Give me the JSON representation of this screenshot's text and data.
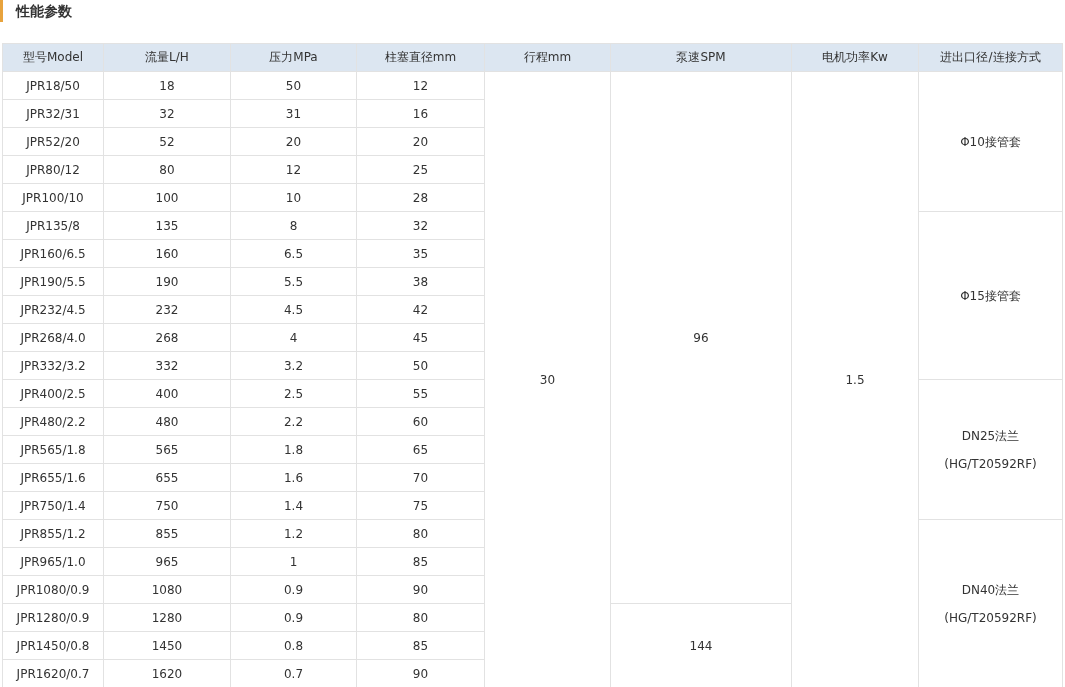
{
  "section_title": "性能参数",
  "table": {
    "columns": [
      "型号Model",
      "流量L/H",
      "压力MPa",
      "柱塞直径mm",
      "行程mm",
      "泵速SPM",
      "电机功率Kw",
      "进出口径/连接方式"
    ],
    "rows": [
      {
        "cells": [
          "JPR18/50",
          "18",
          "50",
          "12"
        ],
        "merged": {
          "stroke": "30",
          "speed": "96",
          "power": "1.5",
          "connection": [
            "Φ10接管套"
          ]
        }
      },
      {
        "cells": [
          "JPR32/31",
          "32",
          "31",
          "16"
        ]
      },
      {
        "cells": [
          "JPR52/20",
          "52",
          "20",
          "20"
        ]
      },
      {
        "cells": [
          "JPR80/12",
          "80",
          "12",
          "25"
        ]
      },
      {
        "cells": [
          "JPR100/10",
          "100",
          "10",
          "28"
        ]
      },
      {
        "cells": [
          "JPR135/8",
          "135",
          "8",
          "32"
        ],
        "merged": {
          "connection": [
            "Φ15接管套"
          ]
        }
      },
      {
        "cells": [
          "JPR160/6.5",
          "160",
          "6.5",
          "35"
        ]
      },
      {
        "cells": [
          "JPR190/5.5",
          "190",
          "5.5",
          "38"
        ]
      },
      {
        "cells": [
          "JPR232/4.5",
          "232",
          "4.5",
          "42"
        ]
      },
      {
        "cells": [
          "JPR268/4.0",
          "268",
          "4",
          "45"
        ]
      },
      {
        "cells": [
          "JPR332/3.2",
          "332",
          "3.2",
          "50"
        ]
      },
      {
        "cells": [
          "JPR400/2.5",
          "400",
          "2.5",
          "55"
        ],
        "merged": {
          "connection": [
            "DN25法兰",
            "(HG/T20592RF)"
          ]
        }
      },
      {
        "cells": [
          "JPR480/2.2",
          "480",
          "2.2",
          "60"
        ]
      },
      {
        "cells": [
          "JPR565/1.8",
          "565",
          "1.8",
          "65"
        ]
      },
      {
        "cells": [
          "JPR655/1.6",
          "655",
          "1.6",
          "70"
        ]
      },
      {
        "cells": [
          "JPR750/1.4",
          "750",
          "1.4",
          "75"
        ]
      },
      {
        "cells": [
          "JPR855/1.2",
          "855",
          "1.2",
          "80"
        ],
        "merged": {
          "connection": [
            "DN40法兰",
            "(HG/T20592RF)"
          ]
        }
      },
      {
        "cells": [
          "JPR965/1.0",
          "965",
          "1",
          "85"
        ]
      },
      {
        "cells": [
          "JPR1080/0.9",
          "1080",
          "0.9",
          "90"
        ]
      },
      {
        "cells": [
          "JPR1280/0.9",
          "1280",
          "0.9",
          "80"
        ],
        "merged": {
          "speed": "144"
        }
      },
      {
        "cells": [
          "JPR1450/0.8",
          "1450",
          "0.8",
          "85"
        ]
      },
      {
        "cells": [
          "JPR1620/0.7",
          "1620",
          "0.7",
          "90"
        ]
      }
    ]
  }
}
